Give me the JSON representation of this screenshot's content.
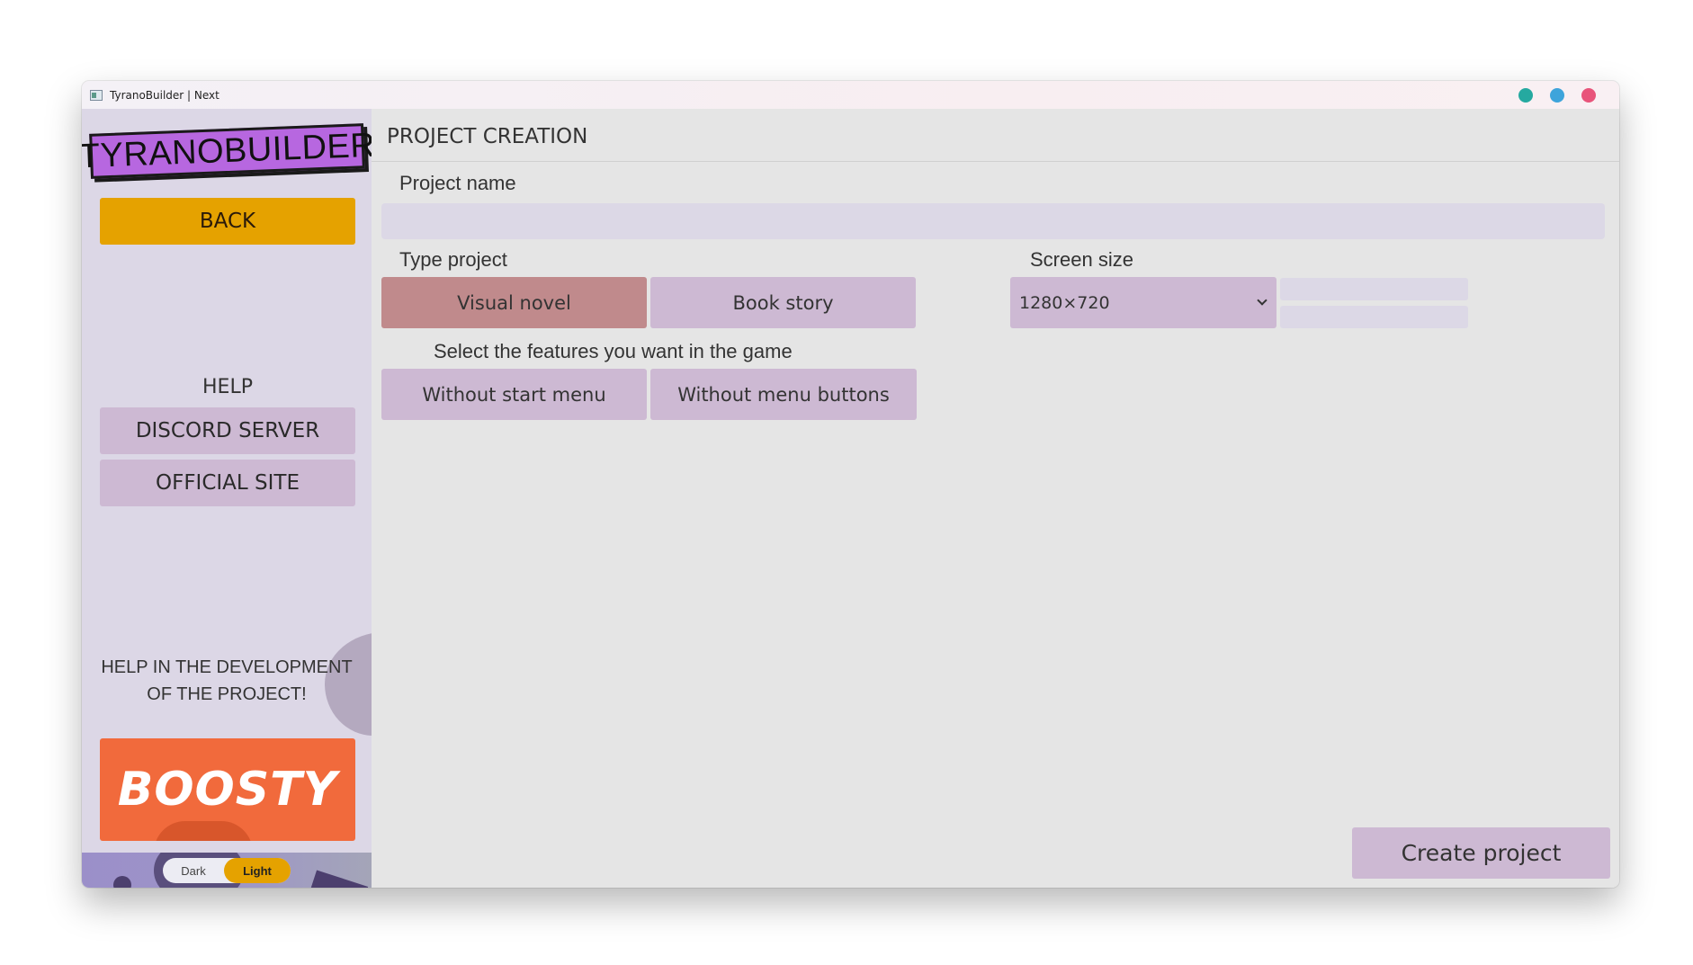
{
  "window": {
    "title": "TyranoBuilder | Next"
  },
  "sidebar": {
    "logo_text": "TYRANOBUILDER",
    "back_label": "BACK",
    "help_heading": "HELP",
    "discord_label": "DISCORD SERVER",
    "site_label": "OFFICIAL SITE",
    "support_line1": "HELP IN THE DEVELOPMENT",
    "support_line2": "OF THE PROJECT!",
    "boosty_label": "BOOSTY",
    "theme": {
      "dark_label": "Dark",
      "light_label": "Light",
      "selected": "Light"
    }
  },
  "main": {
    "title": "PROJECT CREATION",
    "project_name_label": "Project name",
    "project_name_value": "",
    "type_label": "Type project",
    "type_options": [
      "Visual novel",
      "Book story"
    ],
    "type_selected": "Visual novel",
    "screen_size_label": "Screen size",
    "screen_size_value": "1280×720",
    "custom_width": "",
    "custom_height": "",
    "features_label": "Select the features you want in the game",
    "features": [
      "Without start menu",
      "Without menu buttons"
    ],
    "create_label": "Create project"
  },
  "colors": {
    "accent_yellow": "#e5a200",
    "logo_purple": "#b767e0",
    "boosty_orange": "#f16a3c",
    "button_lilac": "#cdb9d3",
    "selected_rose": "#c08a8c",
    "sidebar_bg": "#dcd7e6",
    "main_bg": "#e5e5e5"
  }
}
